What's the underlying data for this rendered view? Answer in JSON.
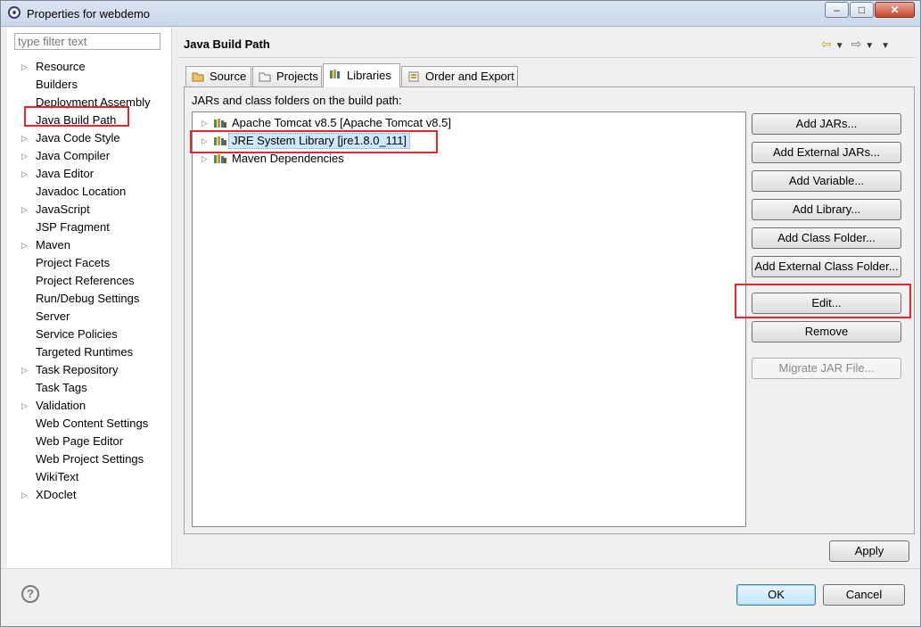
{
  "window": {
    "title": "Properties for webdemo",
    "minimize": "–",
    "maximize": "□",
    "close": "✕"
  },
  "filter": {
    "placeholder": "type filter text"
  },
  "left_tree": [
    {
      "label": "Resource",
      "expandable": true
    },
    {
      "label": "Builders",
      "expandable": false
    },
    {
      "label": "Deployment Assembly",
      "expandable": false
    },
    {
      "label": "Java Build Path",
      "expandable": false,
      "selected": true
    },
    {
      "label": "Java Code Style",
      "expandable": true
    },
    {
      "label": "Java Compiler",
      "expandable": true
    },
    {
      "label": "Java Editor",
      "expandable": true
    },
    {
      "label": "Javadoc Location",
      "expandable": false
    },
    {
      "label": "JavaScript",
      "expandable": true
    },
    {
      "label": "JSP Fragment",
      "expandable": false
    },
    {
      "label": "Maven",
      "expandable": true
    },
    {
      "label": "Project Facets",
      "expandable": false
    },
    {
      "label": "Project References",
      "expandable": false
    },
    {
      "label": "Run/Debug Settings",
      "expandable": false
    },
    {
      "label": "Server",
      "expandable": false
    },
    {
      "label": "Service Policies",
      "expandable": false
    },
    {
      "label": "Targeted Runtimes",
      "expandable": false
    },
    {
      "label": "Task Repository",
      "expandable": true
    },
    {
      "label": "Task Tags",
      "expandable": false
    },
    {
      "label": "Validation",
      "expandable": true
    },
    {
      "label": "Web Content Settings",
      "expandable": false
    },
    {
      "label": "Web Page Editor",
      "expandable": false
    },
    {
      "label": "Web Project Settings",
      "expandable": false
    },
    {
      "label": "WikiText",
      "expandable": false
    },
    {
      "label": "XDoclet",
      "expandable": true
    }
  ],
  "page": {
    "title": "Java Build Path"
  },
  "tabs": [
    {
      "label": "Source"
    },
    {
      "label": "Projects"
    },
    {
      "label": "Libraries",
      "active": true
    },
    {
      "label": "Order and Export"
    }
  ],
  "libraries": {
    "description": "JARs and class folders on the build path:",
    "items": [
      {
        "label": "Apache Tomcat v8.5 [Apache Tomcat v8.5]"
      },
      {
        "label": "JRE System Library [jre1.8.0_111]",
        "selected": true
      },
      {
        "label": "Maven Dependencies"
      }
    ]
  },
  "buttons": {
    "add_jars": "Add JARs...",
    "add_external_jars": "Add External JARs...",
    "add_variable": "Add Variable...",
    "add_library": "Add Library...",
    "add_class_folder": "Add Class Folder...",
    "add_external_class_folder": "Add External Class Folder...",
    "edit": "Edit...",
    "remove": "Remove",
    "migrate_jar": "Migrate JAR File...",
    "apply": "Apply",
    "ok": "OK",
    "cancel": "Cancel"
  },
  "help": {
    "glyph": "?"
  },
  "colors": {
    "highlight_red": "#e3272d",
    "selection_blue": "#cce8ff"
  }
}
